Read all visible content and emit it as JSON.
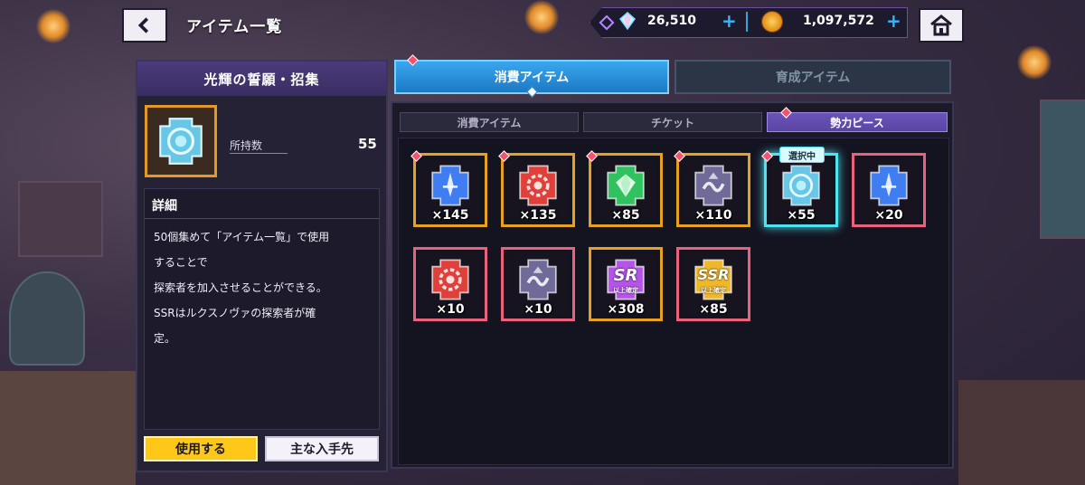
{
  "header": {
    "title": "アイテム一覧",
    "back_icon": "chevron-left-icon",
    "home_icon": "home-icon"
  },
  "currency": {
    "gems": "26,510",
    "coins": "1,097,572",
    "gem_icon": "crystal-icon",
    "coin_icon": "coin-icon"
  },
  "item_panel": {
    "title": "光輝の誓願・招集",
    "owned_label": "所持数",
    "owned_value": "55",
    "detail_heading": "詳細",
    "detail_text": "50個集めて「アイテム一覧」で使用\nすることで\n探索者を加入させることができる。\nSSRはルクスノヴァの探索者が確\n定。",
    "use_button": "使用する",
    "source_button": "主な入手先"
  },
  "main_tabs": [
    {
      "label": "消費アイテム",
      "active": true
    },
    {
      "label": "育成アイテム",
      "active": false
    }
  ],
  "sub_tabs": [
    {
      "label": "消費アイテム",
      "active": false
    },
    {
      "label": "チケット",
      "active": false
    },
    {
      "label": "勢力ピース",
      "active": true
    }
  ],
  "selected_badge": "選択中",
  "items": [
    {
      "qty": "×145",
      "frame": "#e8a11e",
      "piece": "#3f7df0",
      "emblem": "sword",
      "badge": true
    },
    {
      "qty": "×135",
      "frame": "#e8a11e",
      "piece": "#e0403a",
      "emblem": "gear",
      "badge": true
    },
    {
      "qty": "×85",
      "frame": "#e8a11e",
      "piece": "#2fc25e",
      "emblem": "gem",
      "badge": true
    },
    {
      "qty": "×110",
      "frame": "#e8a11e",
      "piece": "#6f6a98",
      "emblem": "wave",
      "badge": true
    },
    {
      "qty": "×55",
      "frame": "#4fe3f0",
      "piece": "#68c6e6",
      "emblem": "ring",
      "badge": true,
      "selected": true
    },
    {
      "qty": "×20",
      "frame": "#e9617b",
      "piece": "#3f7df0",
      "emblem": "sword",
      "badge": false
    },
    {
      "qty": "×10",
      "frame": "#e9617b",
      "piece": "#e0403a",
      "emblem": "gear",
      "badge": false
    },
    {
      "qty": "×10",
      "frame": "#e9617b",
      "piece": "#6f6a98",
      "emblem": "wave",
      "badge": false
    },
    {
      "qty": "×308",
      "frame": "#e8a11e",
      "piece": "#b455e8",
      "emblem": "SR",
      "sublabel": "以上確定",
      "badge": false
    },
    {
      "qty": "×85",
      "frame": "#e9617b",
      "piece": "#f0b72a",
      "emblem": "SSR",
      "sublabel": "以上確定",
      "badge": false
    }
  ]
}
